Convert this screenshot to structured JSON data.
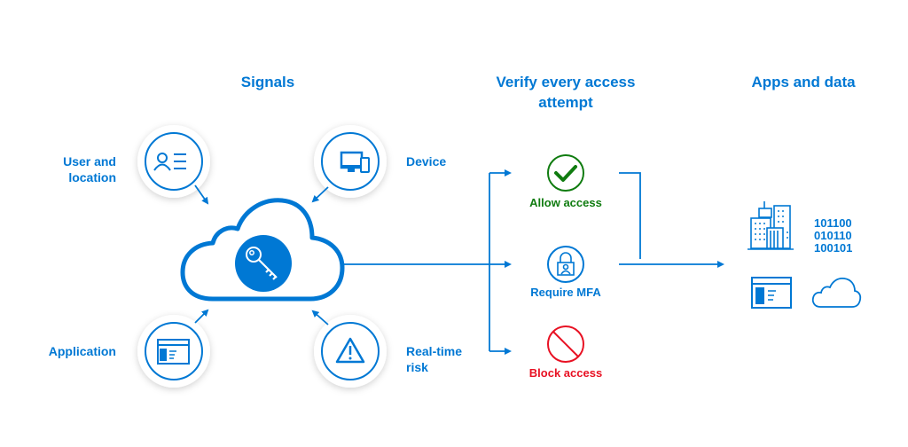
{
  "colors": {
    "primary": "#0078d4",
    "allow": "#107c10",
    "block": "#e81123"
  },
  "headers": {
    "signals": "Signals",
    "verify_line1": "Verify every access",
    "verify_line2": "attempt",
    "apps": "Apps and data"
  },
  "signals": {
    "user_line1": "User and",
    "user_line2": "location",
    "device": "Device",
    "application": "Application",
    "risk_line1": "Real-time",
    "risk_line2": "risk"
  },
  "decisions": {
    "allow": "Allow access",
    "mfa": "Require MFA",
    "block": "Block access"
  },
  "apps": {
    "binary": [
      "101100",
      "010110",
      "100101"
    ]
  },
  "icons": [
    "user-list-icon",
    "devices-icon",
    "app-window-icon",
    "warning-icon",
    "cloud-icon",
    "key-icon",
    "checkmark-icon",
    "lock-user-icon",
    "block-icon",
    "buildings-icon",
    "cloud-outline-icon"
  ]
}
